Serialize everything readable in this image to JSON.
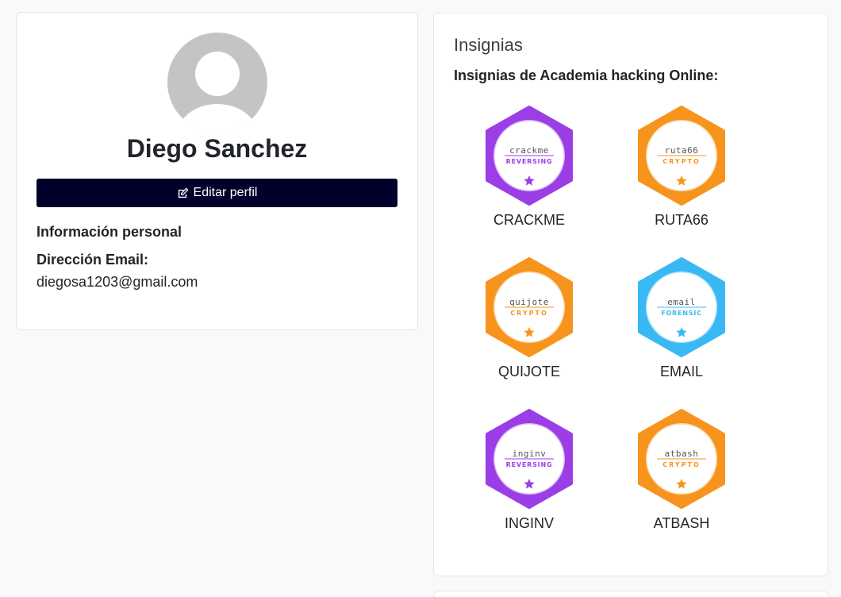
{
  "profile": {
    "name": "Diego Sanchez",
    "edit_button_label": "Editar perfil",
    "personal_info_heading": "Información personal",
    "email_label": "Dirección Email:",
    "email_value": "diegosa1203@gmail.com"
  },
  "badges_panel": {
    "title": "Insignias",
    "subtitle": "Insignias de Academia hacking Online:",
    "badges": [
      {
        "label": "CRACKME",
        "emblem_text": "CRACKME",
        "category": "REVERSING",
        "color": "#9b3ee6"
      },
      {
        "label": "RUTA66",
        "emblem_text": "RUTA66",
        "category": "CRYPTO",
        "color": "#f7941d"
      },
      {
        "label": "QUIJOTE",
        "emblem_text": "QUIJOTE",
        "category": "CRYPTO",
        "color": "#f7941d"
      },
      {
        "label": "EMAIL",
        "emblem_text": "EMAIL",
        "category": "FORENSIC",
        "color": "#39b9f4"
      },
      {
        "label": "INGINV",
        "emblem_text": "INGINV",
        "category": "REVERSING",
        "color": "#9b3ee6"
      },
      {
        "label": "ATBASH",
        "emblem_text": "ATBASH",
        "category": "CRYPTO",
        "color": "#f7941d"
      }
    ]
  },
  "colors": {
    "button_bg": "#02002a",
    "reversing": "#9b3ee6",
    "crypto": "#f7941d",
    "forensic": "#39b9f4",
    "avatar_gray": "#c4c4c4"
  },
  "icons": {
    "avatar": "user-silhouette-icon",
    "edit": "edit-icon",
    "badge_star": "star-icon"
  }
}
